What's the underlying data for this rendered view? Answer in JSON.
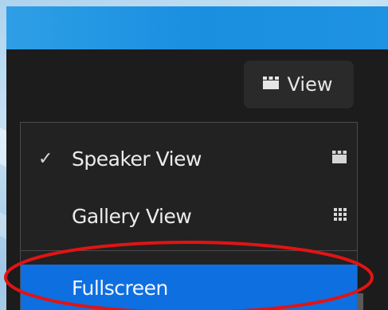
{
  "colors": {
    "titlebar": "#1f92e2",
    "panel": "#1c1c1c",
    "menu_bg": "#222222",
    "selected_bg": "#0e6fe0",
    "highlight_ring": "#e01414"
  },
  "toolbar": {
    "view_button": {
      "label": "View",
      "icon": "speaker-view-icon"
    }
  },
  "view_menu": {
    "items": [
      {
        "label": "Speaker View",
        "checked": true,
        "icon": "speaker-view-icon"
      },
      {
        "label": "Gallery View",
        "checked": false,
        "icon": "gallery-view-icon"
      },
      {
        "label": "Fullscreen",
        "checked": false,
        "highlighted": true
      }
    ],
    "check_glyph": "✓"
  }
}
